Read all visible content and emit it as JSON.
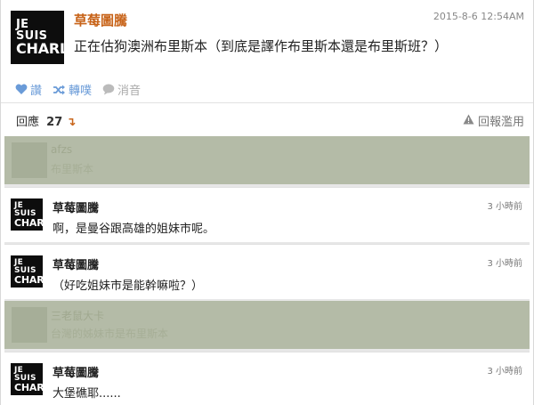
{
  "post": {
    "avatar": {
      "line1": "JE SUIS",
      "line2": "CHARLIE"
    },
    "author": "草莓圖騰",
    "time": "2015-8-6 12:54AM",
    "text": "正在估狗澳洲布里斯本（到底是譯作布里斯本還是布里斯班？）"
  },
  "actions": {
    "like": "讚",
    "repost": "轉噗",
    "mute": "消音"
  },
  "replies": {
    "label": "回應",
    "count": "27",
    "arrow": "↴",
    "report": "回報濫用"
  },
  "hidden": [
    {
      "name": "afzs",
      "text": "布里斯本",
      "time": ""
    },
    {
      "name": "三老鼠大卡",
      "text": "台灣的姊妹市是布里斯本",
      "time": ""
    }
  ],
  "comments": [
    {
      "avatar": {
        "line1": "JE SUIS",
        "line2": "CHARLIE"
      },
      "name": "草莓圖騰",
      "time": "3 小時前",
      "text": "啊，是曼谷跟高雄的姐妹市呢。"
    },
    {
      "avatar": {
        "line1": "JE SUIS",
        "line2": "CHARLIE"
      },
      "name": "草莓圖騰",
      "time": "3 小時前",
      "text": "（好吃姐妹市是能幹嘛啦？）"
    },
    {
      "avatar": {
        "line1": "JE SUIS",
        "line2": "CHARLIE"
      },
      "name": "草莓圖騰",
      "time": "3 小時前",
      "text": "大堡礁耶......"
    }
  ],
  "colors": {
    "author": "#c8641a",
    "action": "#6a9bd8",
    "hidden_overlay": "#b4bba7",
    "list_bg": "#e7e7e7"
  }
}
